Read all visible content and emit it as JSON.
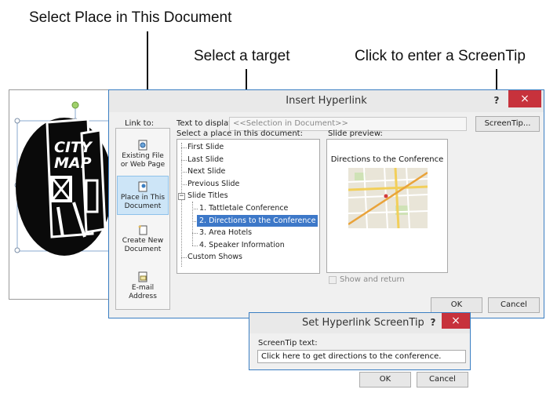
{
  "callouts": {
    "place_in_doc": "Select Place in This Document",
    "select_target": "Select a target",
    "screentip": "Click to enter a ScreenTip"
  },
  "slide_logo": [
    "CITY",
    "MAP"
  ],
  "hyperlink_dialog": {
    "title": "Insert Hyperlink",
    "help": "?",
    "close": "×",
    "link_to_label": "Link to:",
    "text_to_display_label": "Text to display:",
    "text_to_display_value": "<<Selection in Document>>",
    "screentip_button": "ScreenTip...",
    "nav": [
      {
        "line1": "Existing File",
        "line2": "or Web Page"
      },
      {
        "line1": "Place in This",
        "line2": "Document"
      },
      {
        "line1": "Create New",
        "line2": "Document"
      },
      {
        "line1": "E-mail",
        "line2": "Address"
      }
    ],
    "select_place_label": "Select a place in this document:",
    "tree": {
      "first": "First Slide",
      "last": "Last Slide",
      "next": "Next Slide",
      "previous": "Previous Slide",
      "titles": "Slide Titles",
      "titles_expander": "−",
      "s1": "1. Tattletale Conference",
      "s2": "2. Directions to the Conference",
      "s3": "3. Area Hotels",
      "s4": "4. Speaker Information",
      "custom": "Custom Shows"
    },
    "slide_preview_label": "Slide preview:",
    "preview_title": "Directions to the Conference",
    "show_and_return": "Show and return",
    "ok": "OK",
    "cancel": "Cancel"
  },
  "screentip_dialog": {
    "title": "Set Hyperlink ScreenTip",
    "help": "?",
    "close": "×",
    "label": "ScreenTip text:",
    "value": "Click here to get directions to the conference.",
    "ok": "OK",
    "cancel": "Cancel"
  },
  "colors": {
    "accent": "#3d78c8",
    "close_button": "#c7323c",
    "selection_nav": "#cde5f7"
  }
}
